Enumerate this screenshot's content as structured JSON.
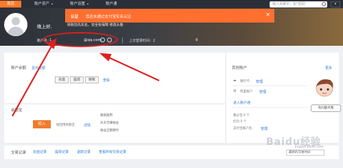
{
  "nav": {
    "tabs": [
      {
        "label": "首页"
      },
      {
        "label": "账户资产"
      },
      {
        "label": "账户设置"
      },
      {
        "label": "账户通"
      }
    ],
    "caret": "▾",
    "search_placeholder": "输入关键字，如\"密码\"",
    "dropdown": "▾"
  },
  "toast": {
    "title": "认证",
    "message": "您还未通过支付宝实名认证",
    "close": "✕"
  },
  "profile": {
    "greeting": "晚上好,",
    "tip": "转账前先实名，安全有保障 修改头像",
    "account_label": "账户名：",
    "account_value": "1",
    "email": "@qq.com",
    "last_login_label": "上次登录时间：2",
    "last_login_tail": "9"
  },
  "balance": {
    "title": "账户余额",
    "toggle_link": "显示金额",
    "buttons": [
      "充值",
      "提现",
      "转账"
    ],
    "view_link": "查看"
  },
  "yuebao": {
    "title": "余额宝",
    "transfer_in": "转入",
    "desc": "赎回用余额宝",
    "detail_link": "详情",
    "bullets": [
      "随取随用",
      "天天可赚收益",
      "收益全额随时"
    ]
  },
  "other": {
    "title": "其他账户",
    "more": "更多",
    "bank_label": "银行卡:",
    "bank_link": "管理",
    "alipay_label": "阿里账户:",
    "alipay_link": "管理",
    "enter_link": "进入账户通",
    "points": "集分宝 0 个",
    "redpack": "红包 0 个",
    "payment_label": "支付宝账户名：",
    "payment_link": "管理"
  },
  "helper": {
    "bubble": "有问题点我"
  },
  "transactions": {
    "title": "交易记录",
    "links": [
      "充值记录",
      "提现记录",
      "退款记录",
      "查看所有交易记录"
    ],
    "sort": "最新的交易时间"
  },
  "watermark": {
    "text": "Baidu经验",
    "sub": "jingyan.baidu.com"
  },
  "colors": {
    "accent": "#ff7a2a",
    "nav_bg": "#2b2f38",
    "link": "#2b7bd6",
    "annotation": "#e02020"
  }
}
